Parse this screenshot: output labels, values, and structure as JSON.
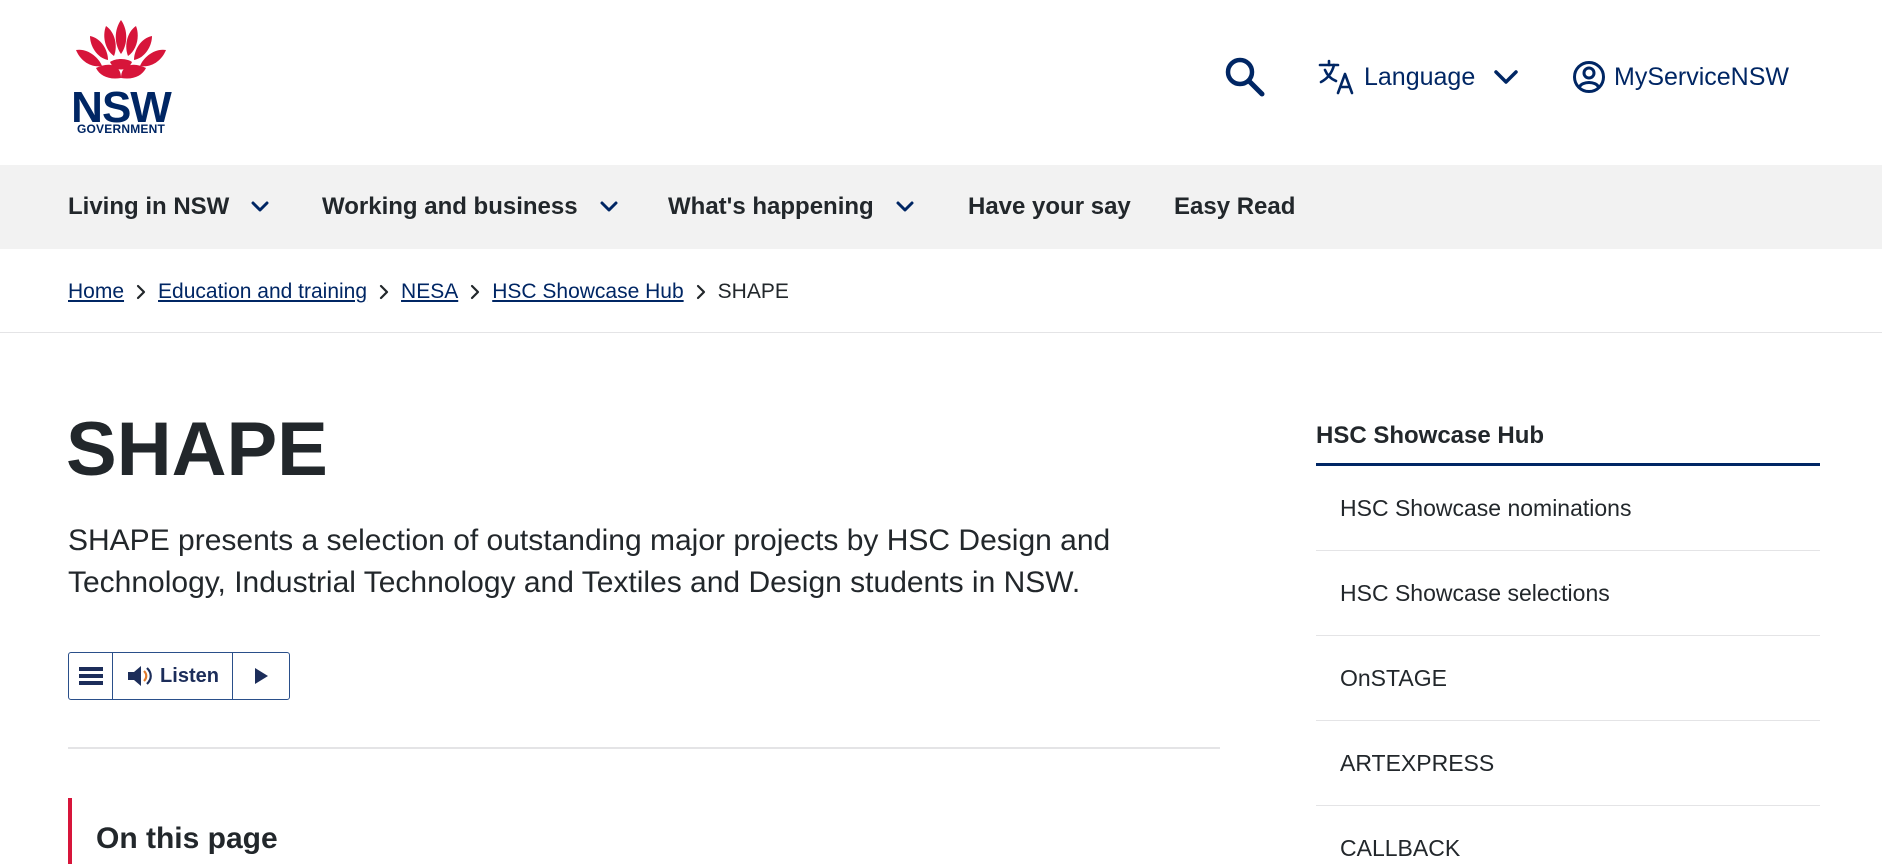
{
  "header": {
    "logo": {
      "word": "NSW",
      "sub": "GOVERNMENT"
    },
    "search_icon": "search-icon",
    "language_label": "Language",
    "account_label": "MyServiceNSW"
  },
  "nav": {
    "items": [
      {
        "label": "Living in NSW",
        "has_menu": true
      },
      {
        "label": "Working and business",
        "has_menu": true
      },
      {
        "label": "What's happening",
        "has_menu": true
      },
      {
        "label": "Have your say",
        "has_menu": false
      },
      {
        "label": "Easy Read",
        "has_menu": false
      }
    ]
  },
  "breadcrumb": {
    "links": [
      "Home",
      "Education and training",
      "NESA",
      "HSC Showcase Hub"
    ],
    "current": "SHAPE"
  },
  "main": {
    "title": "SHAPE",
    "intro": "SHAPE presents a selection of outstanding major projects by HSC Design and Technology, Industrial Technology and Textiles and Design students in NSW.",
    "listen_label": "Listen",
    "on_this_page": "On this page"
  },
  "sidebar": {
    "title": "HSC Showcase Hub",
    "items": [
      {
        "label": "HSC Showcase nominations"
      },
      {
        "label": "HSC Showcase selections"
      },
      {
        "label": "OnSTAGE"
      },
      {
        "label": "ARTEXPRESS"
      },
      {
        "label": "CALLBACK"
      }
    ]
  },
  "colors": {
    "brand_navy": "#002664",
    "brand_red": "#d7153a",
    "nav_bg": "#f2f2f2",
    "text": "#22272b"
  }
}
